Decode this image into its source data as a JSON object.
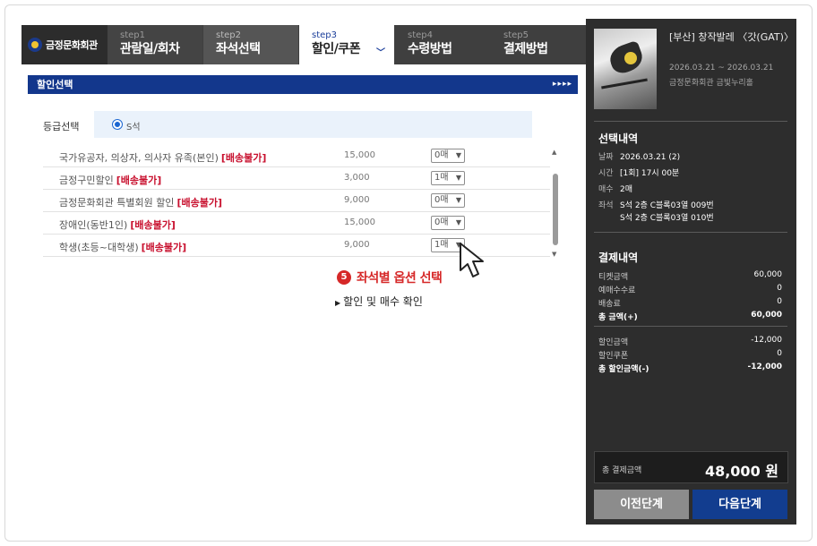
{
  "brand": {
    "name": "금정문화회관"
  },
  "steps": [
    {
      "num": "step1",
      "title": "관람일/회차"
    },
    {
      "num": "step2",
      "title": "좌석선택"
    },
    {
      "num": "step3",
      "title": "할인/쿠폰"
    },
    {
      "num": "step4",
      "title": "수령방법"
    },
    {
      "num": "step5",
      "title": "결제방법"
    }
  ],
  "discount": {
    "header": "할인선택",
    "header_arrows": "▸▸▸▸",
    "grade_label": "등급선택",
    "grade_option": "S석",
    "rows": [
      {
        "name": "국가유공자, 의상자, 의사자 유족(본인)",
        "tag": "[배송불가]",
        "price": "15,000",
        "qty": "0매"
      },
      {
        "name": "금정구민할인",
        "tag": "[배송불가]",
        "price": "3,000",
        "qty": "1매"
      },
      {
        "name": "금정문화회관 특별회원 할인",
        "tag": "[배송불가]",
        "price": "9,000",
        "qty": "0매"
      },
      {
        "name": "장애인(동반1인)",
        "tag": "[배송불가]",
        "price": "15,000",
        "qty": "0매"
      },
      {
        "name": "학생(초등~대학생)",
        "tag": "[배송불가]",
        "price": "9,000",
        "qty": "1매"
      }
    ]
  },
  "annotation": {
    "num": "5",
    "text": "좌석별 옵션 선택",
    "sub": "할인 및 매수 확인"
  },
  "show": {
    "title": "[부산] 창작발레 〈갓(GAT)〉",
    "date": "2026.03.21 ~ 2026.03.21",
    "venue": "금정문화회관 금빛누리홀"
  },
  "selection": {
    "title": "선택내역",
    "date_label": "날짜",
    "date": "2026.03.21 (2)",
    "time_label": "시간",
    "time": "[1회] 17시 00분",
    "count_label": "매수",
    "count": "2매",
    "seat_label": "좌석",
    "seats": [
      "S석 2층 C블록03열 009번",
      "S석 2층 C블록03열 010번"
    ]
  },
  "payment": {
    "title": "결제내역",
    "ticket_label": "티켓금액",
    "ticket": "60,000",
    "fee_label": "예매수수료",
    "fee": "0",
    "ship_label": "배송료",
    "ship": "0",
    "total_label": "총 금액(+)",
    "total": "60,000",
    "disc_label": "할인금액",
    "disc": "-12,000",
    "coupon_label": "할인쿠폰",
    "coupon": "0",
    "disc_total_label": "총 할인금액(-)",
    "disc_total": "-12,000",
    "final_label": "총 결제금액",
    "final": "48,000 원"
  },
  "buttons": {
    "prev": "이전단계",
    "next": "다음단계"
  },
  "colors": {
    "navy": "#13378c",
    "red": "#d62828",
    "sidebar": "#2d2d2d"
  }
}
